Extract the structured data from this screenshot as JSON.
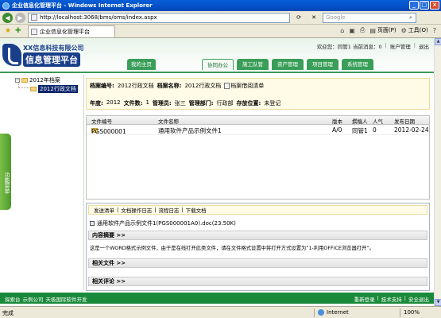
{
  "window": {
    "title": "企业信息化管理平台 - Windows Internet Explorer"
  },
  "browser": {
    "address": "http://localhost:3068/bms/oms/index.aspx",
    "search_placeholder": "Google",
    "tab_title": "企业信息化管理平台",
    "cmd_page": "页面(P)",
    "cmd_tools": "工具(O)"
  },
  "header": {
    "company": "XX信息科技有限公司",
    "platform": "信息管理平台",
    "welcome": "欢迎您：同管1 当前消息：0",
    "account_link": "账户管理",
    "logout_link": "退出",
    "nav": [
      {
        "label": "我的主页"
      },
      {
        "label": "协同办公"
      },
      {
        "label": "施工队管"
      },
      {
        "label": "资产管理"
      },
      {
        "label": "项目管理"
      },
      {
        "label": "系统管理"
      }
    ]
  },
  "sidebar": {
    "root_label": "2012年档案",
    "child_label": "2012行政文档",
    "toggle_label": "功能菜单"
  },
  "archive": {
    "label_code": "档案编号:",
    "code": "2012行政文档",
    "label_name": "档案名称:",
    "name": "2012行政文档",
    "reader_link": "档案借阅清单",
    "label_year": "年度:",
    "year": "2012",
    "label_count": "文件数:",
    "count": "1",
    "label_admin": "管理员:",
    "admin": "张三",
    "label_dept": "管理部门:",
    "dept": "行政部",
    "label_location": "存放位置:",
    "location": "未登记"
  },
  "table": {
    "headers": [
      "文件编号",
      "文件名称",
      "版本",
      "撰稿人",
      "人气",
      "发布日期"
    ],
    "rows": [
      {
        "code": "PGS000001",
        "name": "通用软件产品示例文件1",
        "version": "A/0",
        "author": "同管1",
        "views": "0",
        "date": "2012-02-24"
      }
    ]
  },
  "detail": {
    "tabs": [
      "发送清单",
      "文档操作日志",
      "流程日志",
      "下载文档"
    ],
    "attachment": "通用软件产品示例文件1(PGS000001A0).doc(23.50K)",
    "summary_title": "内容摘要 >>",
    "summary_text": "这是一个WORD格式示例文件，由于是在线打开此类文件，请在文件格式设置中将打开方式设置为“1-利用OFFICE浏览器打开”。",
    "related_files_title": "相关文件 >>",
    "related_comments_title": "相关评论 >>"
  },
  "footer": {
    "left": [
      "探索台",
      "示例公司",
      "天极国际软件开发"
    ],
    "right": [
      "重新登录",
      "技术支持",
      "安全退出"
    ]
  },
  "status": {
    "text": "完成",
    "zone": "Internet",
    "zoom": "100%"
  }
}
